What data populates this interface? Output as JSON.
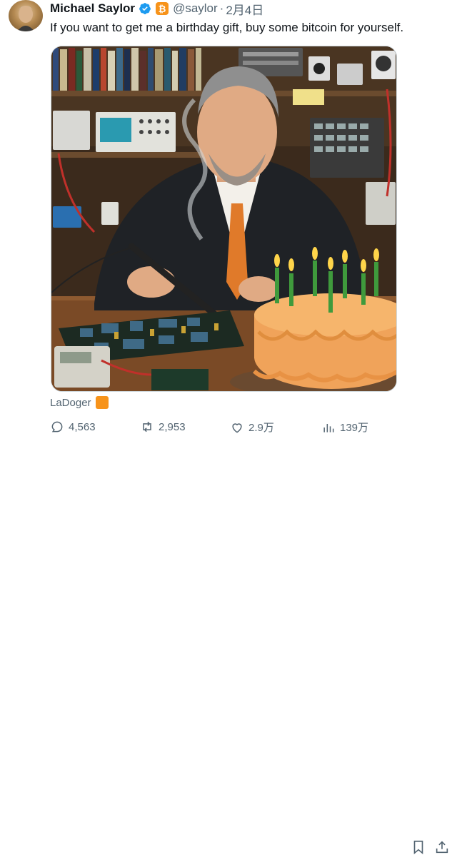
{
  "author": {
    "name": "Michael Saylor",
    "handle": "@saylor",
    "separator": "·",
    "date": "2月4日",
    "bitcoin_badge": "₿"
  },
  "tweet": {
    "text": "If you want to get me a birthday gift, buy some bitcoin for yourself."
  },
  "media": {
    "credit": "LaDoger"
  },
  "actions": {
    "replies": "4,563",
    "retweets": "2,953",
    "likes": "2.9万",
    "views": "139万"
  },
  "colors": {
    "text": "#0f1419",
    "secondary": "#536471",
    "verified": "#1d9bf0",
    "bitcoin": "#f7931a"
  }
}
